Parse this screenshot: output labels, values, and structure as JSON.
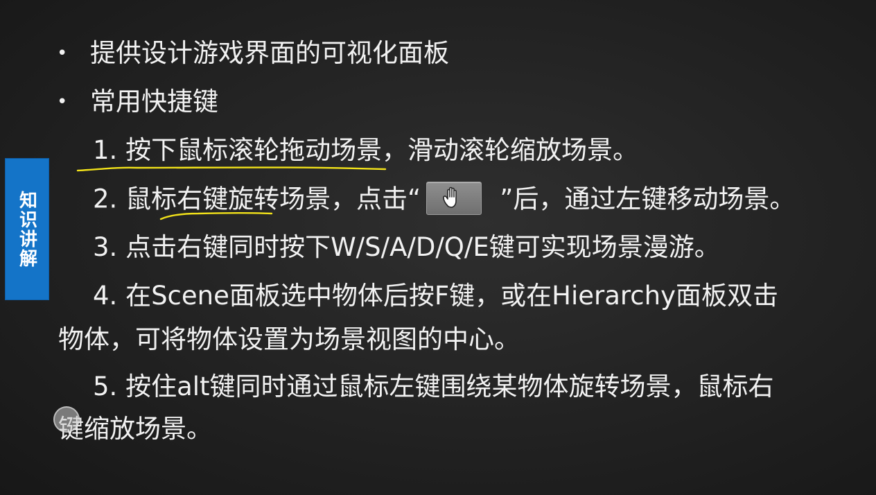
{
  "side_tab": {
    "label": "知识讲解",
    "color": "#1474c8"
  },
  "bullets": [
    {
      "symbol": "•",
      "text": "提供设计游戏界面的可视化面板"
    },
    {
      "symbol": "•",
      "text": "常用快捷键"
    }
  ],
  "items": {
    "item1": "1. 按下鼠标滚轮拖动场景，滑动滚轮缩放场景。",
    "item2_before": "2. 鼠标右键旋转场景，点击“",
    "item2_icon": "hand-tool-icon",
    "item2_after": "”后，通过左键移动场景。",
    "item3": "3. 点击右键同时按下W/S/A/D/Q/E键可实现场景漫游。",
    "item4_line1": "4. 在Scene面板选中物体后按F键，或在Hierarchy面板双击",
    "item4_line2": "物体，可将物体设置为场景视图的中心。",
    "item5_line1": "5. 按住alt键同时通过鼠标左键围绕某物体旋转场景，鼠标右",
    "item5_line2": "键缩放场景。"
  },
  "annotation_color": "#f2e21a",
  "text_color": "#f2f2f2",
  "background_color": "#262626"
}
